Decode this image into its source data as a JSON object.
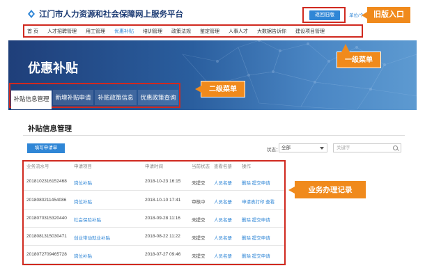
{
  "header": {
    "site_title": "江门市人力资源和社会保障网上服务平台",
    "old_version_button": "返回旧版",
    "login_link": "单位/个人登录",
    "old_entry_tag": "旧版入口"
  },
  "nav": {
    "items": [
      "首 页",
      "人才招聘管理",
      "用工管理",
      "优惠补贴",
      "培训管理",
      "政策法规",
      "鉴定管理",
      "人事人才",
      "大数据告诉你",
      "建设项目管理"
    ],
    "active_index": 3,
    "level1_tag": "一级菜单"
  },
  "banner": {
    "title": "优惠补贴",
    "tabs": [
      "补贴信息管理",
      "新增补贴申请",
      "补贴政策信息",
      "优惠政策查询"
    ],
    "level2_tag": "二级菜单"
  },
  "content": {
    "section_title": "补贴信息管理",
    "new_application_button": "填写申请单",
    "status_filter_label": "状态：",
    "status_filter_value": "全部",
    "search_placeholder": "关键字",
    "records_tag": "业务办理记录"
  },
  "table": {
    "headers": [
      "业务流水号",
      "申请项目",
      "申请时间",
      "当前状态",
      "查看名册",
      "操作"
    ],
    "rows": [
      {
        "serial": "2018102316152468",
        "item": "岗位补贴",
        "time": "2018-10-23 16:15",
        "status": "未提交",
        "roster": "人员名册",
        "actions": "删除  提交申请"
      },
      {
        "serial": "2018080211454086",
        "item": "岗位补贴",
        "time": "2018-10-10 17:41",
        "status": "审核中",
        "roster": "人员名册",
        "actions": "申请表打印  查看"
      },
      {
        "serial": "2018070315320440",
        "item": "社会保险补贴",
        "time": "2018-09-28 11:16",
        "status": "未提交",
        "roster": "人员名册",
        "actions": "删除  提交申请"
      },
      {
        "serial": "2018081315030471",
        "item": "创业带动就业补贴",
        "time": "2018-08-22 11:22",
        "status": "未提交",
        "roster": "人员名册",
        "actions": "删除  提交申请"
      },
      {
        "serial": "2018072709465728",
        "item": "岗位补贴",
        "time": "2018-07-27 09:46",
        "status": "未提交",
        "roster": "人员名册",
        "actions": "删除  提交申请"
      }
    ]
  },
  "colors": {
    "accent": "#2f86d6",
    "annotation_tag": "#f08a1c",
    "highlight_border": "#d0291f",
    "banner": "#1f3f7a"
  }
}
